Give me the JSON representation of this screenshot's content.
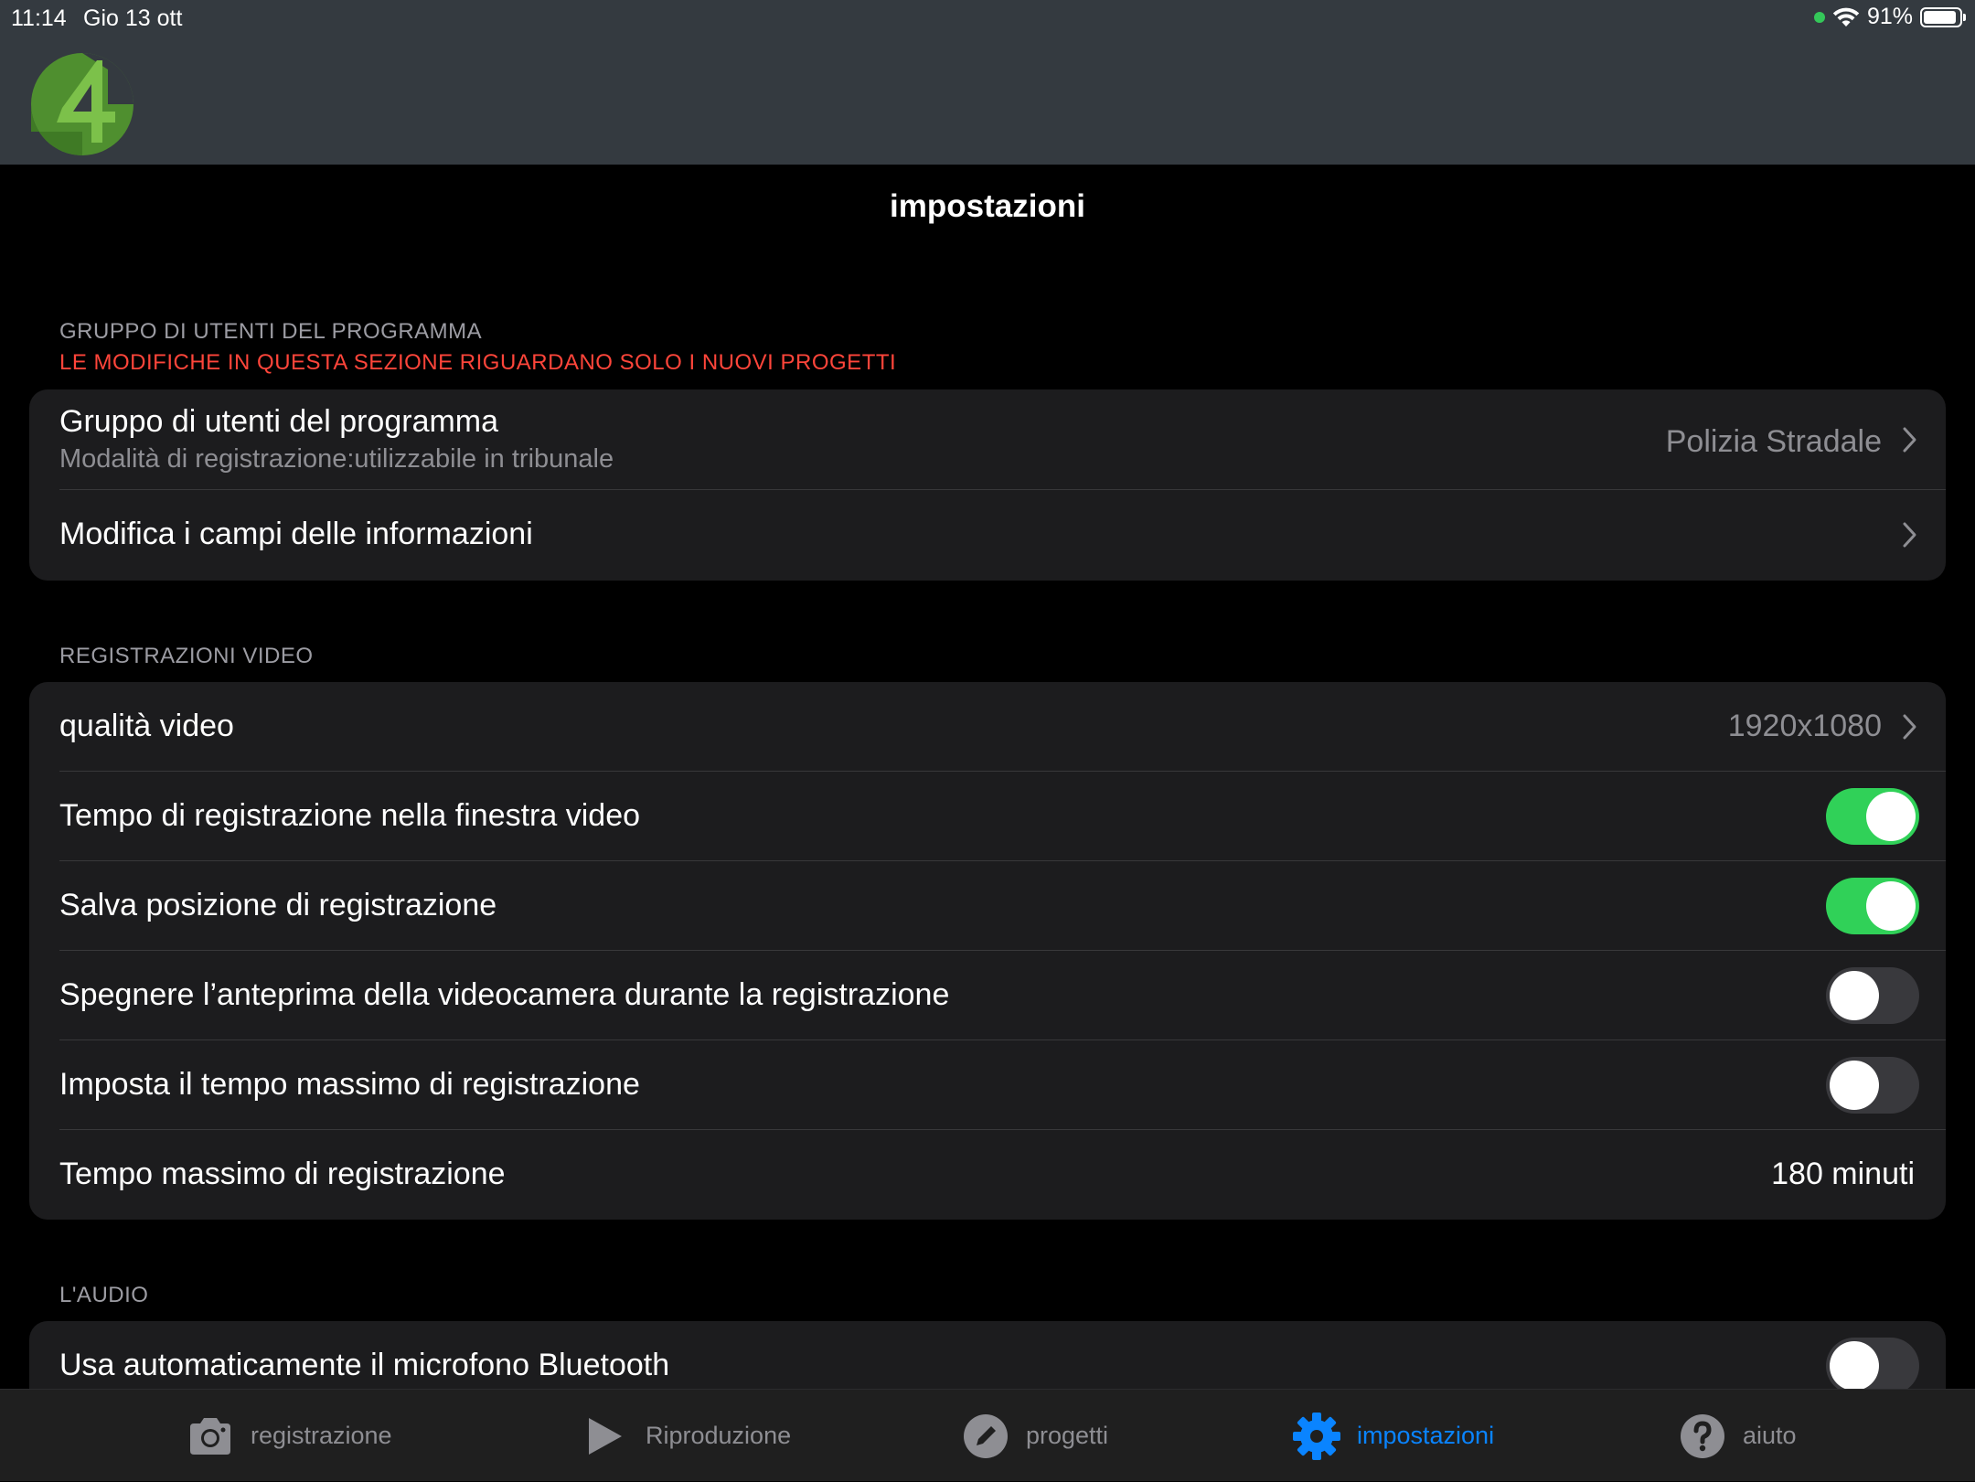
{
  "status": {
    "time": "11:14",
    "date": "Gio 13 ott",
    "battery": "91%",
    "battery_level": 0.91
  },
  "page": {
    "title": "impostazioni"
  },
  "sections": {
    "users": {
      "header": "GRUPPO DI UTENTI DEL PROGRAMMA",
      "warning": "LE MODIFICHE IN QUESTA SEZIONE RIGUARDANO SOLO I NUOVI PROGETTI",
      "group_label": "Gruppo di utenti del programma",
      "group_sublabel": "Modalità di registrazione:utilizzabile in tribunale",
      "group_value": "Polizia Stradale",
      "edit_fields_label": "Modifica i campi delle informazioni"
    },
    "video": {
      "header": "REGISTRAZIONI VIDEO",
      "quality_label": "qualità video",
      "quality_value": "1920x1080",
      "rec_time_label": "Tempo di registrazione nella finestra video",
      "rec_time_on": true,
      "save_pos_label": "Salva posizione di registrazione",
      "save_pos_on": true,
      "preview_off_label": "Spegnere l’anteprima della videocamera durante la registrazione",
      "preview_off_on": false,
      "max_time_toggle_label": "Imposta il tempo massimo di registrazione",
      "max_time_toggle_on": false,
      "max_time_label": "Tempo massimo di registrazione",
      "max_time_value": "180 minuti"
    },
    "audio": {
      "header": "L'AUDIO",
      "bluetooth_label": "Usa automaticamente il microfono Bluetooth",
      "bluetooth_on": false
    }
  },
  "tabs": {
    "recording": "registrazione",
    "playback": "Riproduzione",
    "projects": "progetti",
    "settings": "impostazioni",
    "help": "aiuto"
  },
  "colors": {
    "accent": "#0a84ff",
    "toggle_on": "#30d158",
    "warning": "#ff453a",
    "header_bg": "#343a40"
  }
}
